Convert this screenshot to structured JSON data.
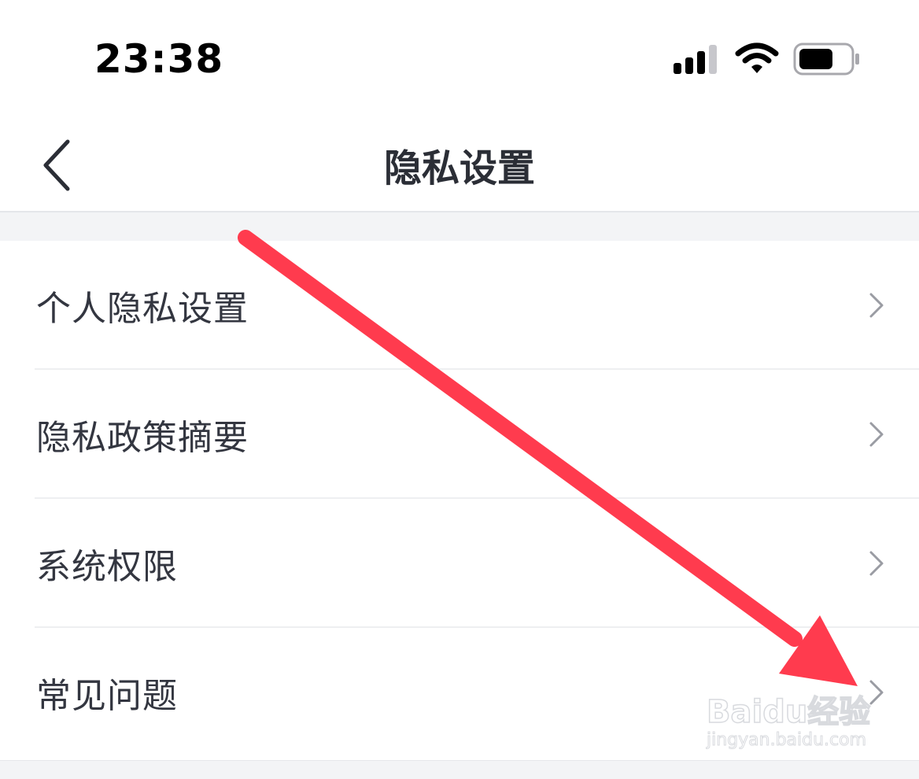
{
  "status_bar": {
    "time": "23:38",
    "icons": [
      "signal-icon",
      "wifi-icon",
      "battery-icon"
    ]
  },
  "nav": {
    "back_icon": "chevron-left-icon",
    "title": "隐私设置"
  },
  "list": {
    "items": [
      {
        "label": "个人隐私设置",
        "icon": "chevron-right-icon"
      },
      {
        "label": "隐私政策摘要",
        "icon": "chevron-right-icon"
      },
      {
        "label": "系统权限",
        "icon": "chevron-right-icon"
      },
      {
        "label": "常见问题",
        "icon": "chevron-right-icon"
      }
    ]
  },
  "annotation": {
    "color": "#ff3b4e"
  },
  "watermark": {
    "logo": "Baidu经验",
    "url": "jingyan.baidu.com"
  },
  "colors": {
    "title_text": "#2b2e36",
    "item_text": "#333640",
    "chevron": "#9a9ca3",
    "gap": "#f3f4f6"
  }
}
